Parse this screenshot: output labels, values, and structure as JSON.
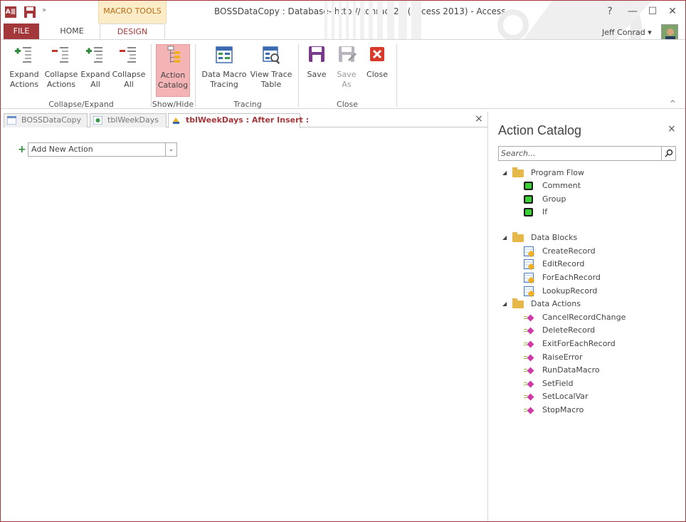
{
  "titlebar": {
    "app_icon": "A≣",
    "save_icon": "save-icon",
    "customize_qat": "»",
    "context_group": "MACRO TOOLS",
    "title": "BOSSDataCopy : Database- http://conradr2f/ (Access 2013) - Access",
    "help": "?",
    "minimize": "—",
    "restore": "☐",
    "close": "✕",
    "user_name": "Jeff Conrad ▾"
  },
  "tabs": {
    "file": "FILE",
    "home": "HOME",
    "design": "DESIGN"
  },
  "ribbon": {
    "expand_actions": [
      "Expand",
      "Actions"
    ],
    "collapse_actions": [
      "Collapse",
      "Actions"
    ],
    "expand_all": [
      "Expand",
      "All"
    ],
    "collapse_all": [
      "Collapse",
      "All"
    ],
    "action_catalog": [
      "Action",
      "Catalog"
    ],
    "data_macro_tracing": [
      "Data Macro",
      "Tracing"
    ],
    "view_trace_table": [
      "View Trace",
      "Table"
    ],
    "save": "Save",
    "save_as": [
      "Save",
      "As"
    ],
    "close": "Close",
    "groups": {
      "collapse_expand": "Collapse/Expand",
      "show_hide": "Show/Hide",
      "tracing": "Tracing",
      "close": "Close"
    },
    "collapse_ribbon": "^"
  },
  "doc_tabs": [
    {
      "label": "BOSSDataCopy",
      "icon": "database-icon"
    },
    {
      "label": "tblWeekDays",
      "icon": "table-icon"
    },
    {
      "label": "tblWeekDays : After Insert :",
      "icon": "macro-icon"
    }
  ],
  "doc_close": "×",
  "designer": {
    "add_new_action": "Add New Action",
    "dropdown_arrow": "⌄"
  },
  "catalog": {
    "title": "Action Catalog",
    "close": "×",
    "search_placeholder": "Search...",
    "search_icon": "⌕",
    "groups": [
      {
        "label": "Program Flow",
        "items": [
          "Comment",
          "Group",
          "If"
        ]
      },
      {
        "label": "Data Blocks",
        "items": [
          "CreateRecord",
          "EditRecord",
          "ForEachRecord",
          "LookupRecord"
        ]
      },
      {
        "label": "Data Actions",
        "items": [
          "CancelRecordChange",
          "DeleteRecord",
          "ExitForEachRecord",
          "RaiseError",
          "RunDataMacro",
          "SetField",
          "SetLocalVar",
          "StopMacro"
        ]
      }
    ]
  },
  "colors": {
    "accent": "#a4373a",
    "context_tab_bg": "#fcecc8",
    "active_button_bg": "#f4b3b5"
  }
}
